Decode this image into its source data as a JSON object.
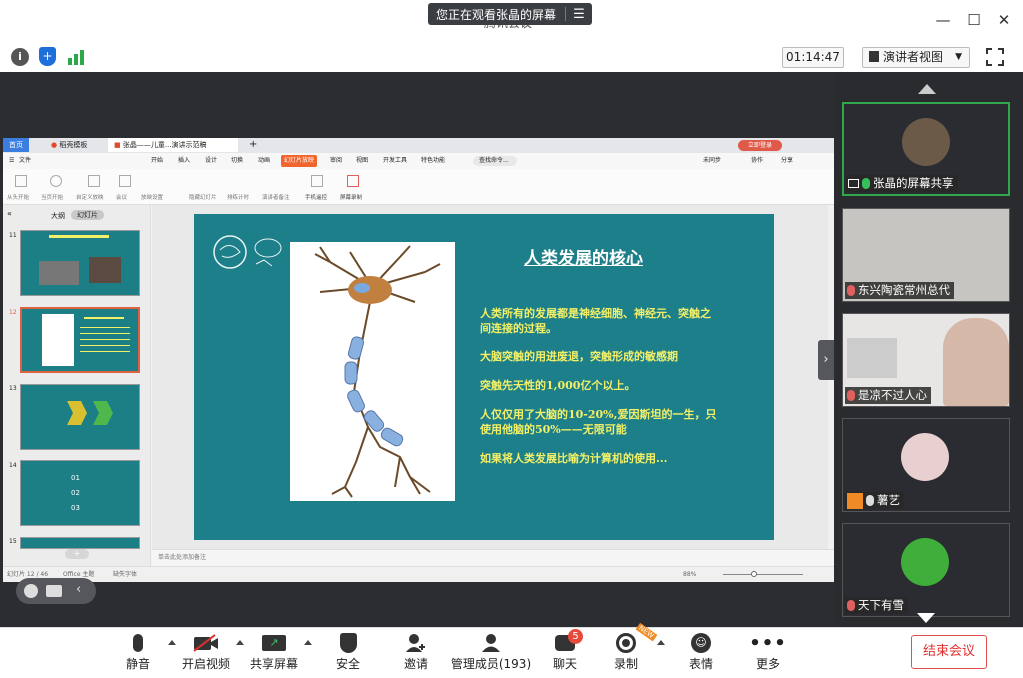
{
  "window": {
    "hidden_title": "腾讯会议",
    "share_banner": "您正在观看张晶的屏幕",
    "minimize": "—",
    "maximize": "☐",
    "close": "✕"
  },
  "toolbar": {
    "timer": "01:14:47",
    "view_mode": "演讲者视图"
  },
  "ppt": {
    "tabs": [
      "首页",
      "稻壳模板",
      "张晶——儿童...演讲示范稿"
    ],
    "login_btn": "立即登录",
    "menu": [
      "文件",
      "开始",
      "插入",
      "设计",
      "切换",
      "动画",
      "幻灯片放映",
      "审阅",
      "视图",
      "开发工具",
      "特色功能"
    ],
    "active_menu": "幻灯片放映",
    "search": "查找命令...",
    "right_menu": [
      "未同步",
      "协作",
      "分享"
    ],
    "ribbon": [
      "从头开始",
      "当页开始",
      "自定义放映",
      "会议",
      "放映设置",
      "隐藏幻灯片",
      "排练计时",
      "演讲者备注",
      "手机遥控",
      "屏幕录制"
    ],
    "pane_tabs": [
      "大纲",
      "幻灯片"
    ],
    "thumb_numbers": [
      "11",
      "12",
      "13",
      "14",
      "15"
    ],
    "thumb4_items": [
      "01",
      "02",
      "03"
    ],
    "notes": "单击此处添加备注",
    "status_left": [
      "幻灯片 12 / 46",
      "Office 主题",
      "缺失字体"
    ],
    "zoom": "88%",
    "slide": {
      "title": "人类发展的核心",
      "para1": "人类所有的发展都是神经细胞、神经元、突触之间连接的过程。",
      "para2": "大脑突触的用进废退，突触形成的敏感期",
      "para3": "突触先天性的1,000亿个以上。",
      "para4": "人仅仅用了大脑的10-20%,爱因斯坦的一生，只使用他脑的50%——无限可能",
      "para5": "如果将人类发展比喻为计算机的使用..."
    }
  },
  "participants": [
    {
      "name": "张晶的屏幕共享",
      "mic": "on"
    },
    {
      "name": "东兴陶瓷常州总代",
      "mic": "off"
    },
    {
      "name": "是凉不过人心",
      "mic": "off"
    },
    {
      "name": "薯艺",
      "mic": "on"
    },
    {
      "name": "天下有雪",
      "mic": "off"
    }
  ],
  "bottom": {
    "mute": "静音",
    "video": "开启视频",
    "share": "共享屏幕",
    "security": "安全",
    "invite": "邀请",
    "members": "管理成员(193)",
    "chat": "聊天",
    "chat_badge": "5",
    "record": "录制",
    "record_tag": "NEW",
    "emoji": "表情",
    "more": "更多",
    "end": "结束会议"
  },
  "colors": {
    "accent_blue": "#1e6fd9",
    "slide_bg": "#1d7f89",
    "end_red": "#e03030"
  }
}
